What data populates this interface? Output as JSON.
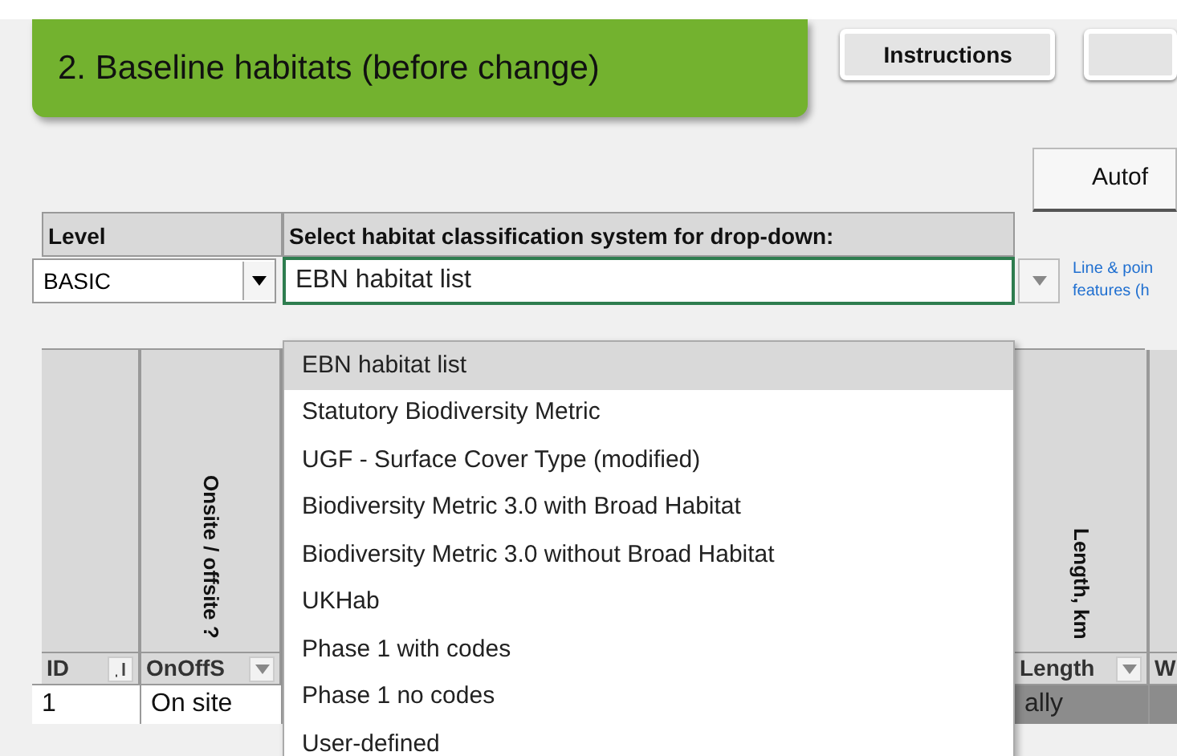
{
  "title_banner": "2. Baseline habitats (before change)",
  "instructions_button": "Instructions",
  "autofit_button": "Autof",
  "level": {
    "header": "Level",
    "value": "BASIC"
  },
  "classification": {
    "header": "Select habitat classification system for drop-down:",
    "value": "EBN habitat list",
    "options": [
      {
        "label": "EBN habitat list",
        "selected": true
      },
      {
        "label": "Statutory Biodiversity Metric",
        "selected": false
      },
      {
        "label": "UGF - Surface Cover Type (modified)",
        "selected": false
      },
      {
        "label": "Biodiversity Metric 3.0 with Broad Habitat",
        "selected": false
      },
      {
        "label": "Biodiversity Metric 3.0 without Broad Habitat",
        "selected": false
      },
      {
        "label": "UKHab",
        "selected": false
      },
      {
        "label": "Phase 1 with codes",
        "selected": false
      },
      {
        "label": "Phase 1 no codes",
        "selected": false
      },
      {
        "label": "User-defined",
        "selected": false
      }
    ]
  },
  "side_note": [
    "Line & poin",
    "features (h"
  ],
  "table": {
    "columns": [
      {
        "filter": "ID",
        "sorted": true
      },
      {
        "heading": "Onsite / offsite ?",
        "filter": "OnOffS",
        "sorted": false
      },
      {},
      {
        "heading": "Length, km",
        "filter": "Length",
        "sorted": false
      },
      {
        "filter": "W"
      }
    ],
    "rows": [
      [
        "1",
        "On site",
        null,
        "ally",
        null
      ]
    ]
  }
}
